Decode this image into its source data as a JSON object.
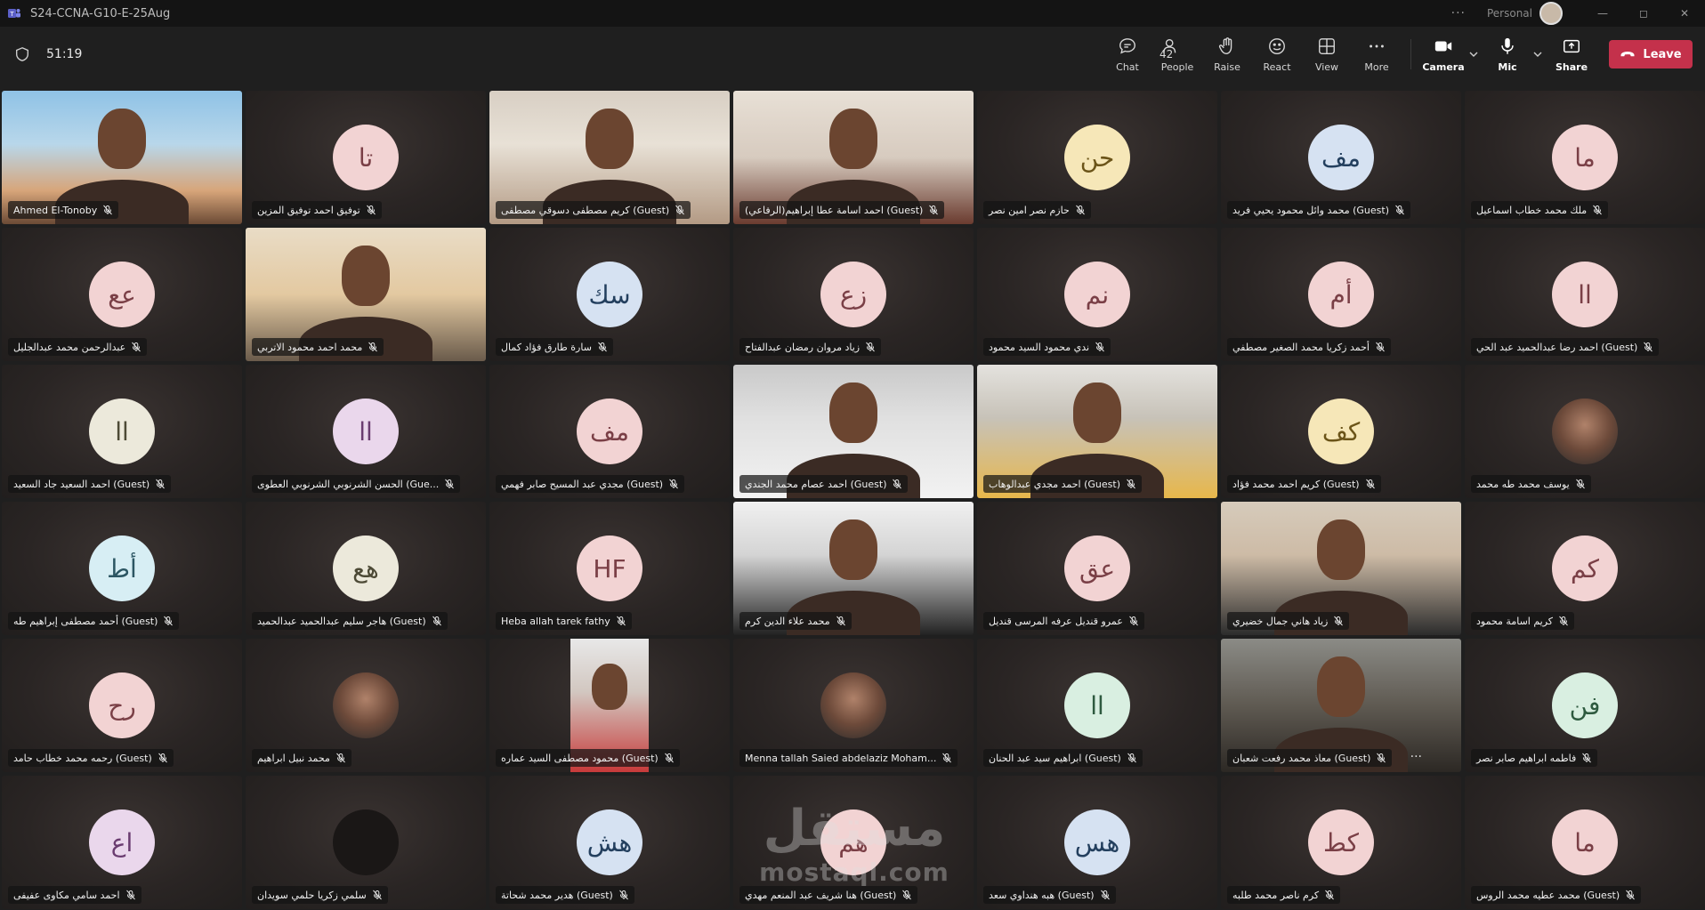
{
  "window": {
    "title": "S24-CCNA-G10-E-25Aug",
    "profile_label": "Personal",
    "more_label": "···"
  },
  "meeting": {
    "timer": "51:19"
  },
  "toolbar": {
    "chat": "Chat",
    "people": "People",
    "people_count": "42",
    "raise": "Raise",
    "react": "React",
    "view": "View",
    "more": "More",
    "camera": "Camera",
    "mic": "Mic",
    "share": "Share",
    "leave": "Leave"
  },
  "colors": {
    "leave": "#c4314b",
    "background": "#1f1f1f"
  },
  "watermark": {
    "ar": "مستقل",
    "latin": "mostaql.com"
  },
  "participants": [
    {
      "name": "Ahmed El-Tonoby",
      "type": "video",
      "style": "v1"
    },
    {
      "name": "توفيق احمد توفيق المزين",
      "type": "avatar",
      "initials": "تا",
      "color": "pink"
    },
    {
      "name": "كريم مصطفى دسوقي مصطفى (Guest)",
      "type": "video",
      "style": "v2"
    },
    {
      "name": "احمد اسامة عطا إبراهيم(الرفاعي) (Guest)",
      "type": "video",
      "style": "v3"
    },
    {
      "name": "حازم نصر امين نصر",
      "type": "avatar",
      "initials": "حن",
      "color": "yellow"
    },
    {
      "name": "محمد وائل محمود يحيي فريد (Guest)",
      "type": "avatar",
      "initials": "مف",
      "color": "blue"
    },
    {
      "name": "ملك محمد خطاب اسماعيل",
      "type": "avatar",
      "initials": "ما",
      "color": "pink"
    },
    {
      "name": "عبدالرحمن محمد عبدالجليل",
      "type": "avatar",
      "initials": "عع",
      "color": "pink"
    },
    {
      "name": "محمد احمد محمود الاتربي",
      "type": "video",
      "style": "v4"
    },
    {
      "name": "سارة طارق فؤاد كمال",
      "type": "avatar",
      "initials": "سك",
      "color": "blue"
    },
    {
      "name": "زياد مروان رمضان عبدالفتاح",
      "type": "avatar",
      "initials": "زع",
      "color": "pink"
    },
    {
      "name": "ندي محمود السيد محمود",
      "type": "avatar",
      "initials": "نم",
      "color": "pink"
    },
    {
      "name": "أحمد زكريا محمد الصغير مصطفي",
      "type": "avatar",
      "initials": "أم",
      "color": "pink"
    },
    {
      "name": "احمد رضا عبدالحميد عبد الحي (Guest)",
      "type": "avatar",
      "initials": "اا",
      "color": "pink"
    },
    {
      "name": "احمد السعيد جاد السعيد (Guest)",
      "type": "avatar",
      "initials": "اا",
      "color": "cream"
    },
    {
      "name": "الحسن الشرنوبي الشرنوبي العطوى (Gue...",
      "type": "avatar",
      "initials": "اا",
      "color": "purple"
    },
    {
      "name": "مجدي عبد المسيح صابر فهمي (Guest)",
      "type": "avatar",
      "initials": "مف",
      "color": "pink"
    },
    {
      "name": "احمد عصام محمد الجندي (Guest)",
      "type": "video",
      "style": "v5"
    },
    {
      "name": "احمد مجدي عبدالوهاب (Guest)",
      "type": "video",
      "style": "v6"
    },
    {
      "name": "كريم احمد محمد فؤاد (Guest)",
      "type": "avatar",
      "initials": "كف",
      "color": "yellow"
    },
    {
      "name": "يوسف محمد طه محمد",
      "type": "photo-avatar"
    },
    {
      "name": "أحمد مصطفى إبراهيم طه (Guest)",
      "type": "avatar",
      "initials": "أط",
      "color": "sky"
    },
    {
      "name": "هاجر سليم عبدالحميد عبدالحميد (Guest)",
      "type": "avatar",
      "initials": "هع",
      "color": "cream"
    },
    {
      "name": "Heba allah tarek fathy",
      "type": "avatar",
      "initials": "HF",
      "color": "pink"
    },
    {
      "name": "محمد علاء الدين كرم",
      "type": "video",
      "style": "v7"
    },
    {
      "name": "عمرو قنديل عرفه المرسى قنديل",
      "type": "avatar",
      "initials": "عق",
      "color": "pink"
    },
    {
      "name": "زياد هاني جمال خضيري",
      "type": "video",
      "style": "v8"
    },
    {
      "name": "كريم اسامة محمود",
      "type": "avatar",
      "initials": "كم",
      "color": "pink"
    },
    {
      "name": "رحمه محمد خطاب حامد (Guest)",
      "type": "avatar",
      "initials": "رح",
      "color": "pink"
    },
    {
      "name": "محمد نبيل ابراهيم",
      "type": "photo-avatar"
    },
    {
      "name": "محمود مصطفى السيد عماره (Guest)",
      "type": "narrow-video"
    },
    {
      "name": "Menna tallah Saied abdelaziz Moham...",
      "type": "photo-avatar"
    },
    {
      "name": "ابراهيم سيد عبد الحنان (Guest)",
      "type": "avatar",
      "initials": "اا",
      "color": "green"
    },
    {
      "name": "معاذ محمد رفعت شعبان (Guest)",
      "type": "video",
      "style": "v9",
      "more": "···"
    },
    {
      "name": "فاطمه ابراهيم صابر نصر",
      "type": "avatar",
      "initials": "فن",
      "color": "green"
    },
    {
      "name": "احمد سامي مكاوى عفيفى",
      "type": "avatar",
      "initials": "اع",
      "color": "purple"
    },
    {
      "name": "سلمي زكريا حلمي سويدان",
      "type": "dark-avatar"
    },
    {
      "name": "هدير محمد شحاتة (Guest)",
      "type": "avatar",
      "initials": "هش",
      "color": "blue"
    },
    {
      "name": "هنا شريف عبد المنعم مهدي (Guest)",
      "type": "avatar",
      "initials": "هم",
      "color": "pink"
    },
    {
      "name": "هبه هنداوي سعد (Guest)",
      "type": "avatar",
      "initials": "هس",
      "color": "blue"
    },
    {
      "name": "كرم ناصر محمد طلبه",
      "type": "avatar",
      "initials": "كط",
      "color": "pink"
    },
    {
      "name": "محمد عطيه محمد الروس (Guest)",
      "type": "avatar",
      "initials": "ما",
      "color": "pink"
    }
  ]
}
